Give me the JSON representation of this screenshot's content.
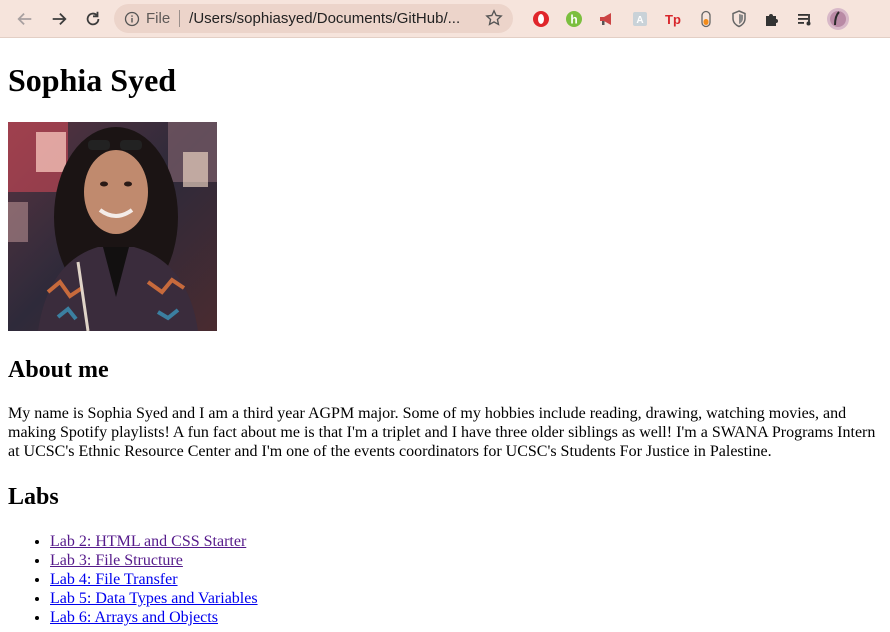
{
  "browser": {
    "scheme": "File",
    "url": "/Users/sophiasyed/Documents/GitHub/...",
    "extensions": [
      "opera-red-icon",
      "honey-h-icon",
      "megaphone-icon",
      "grammar-icon",
      "tp-icon",
      "capsule-icon",
      "shield-icon",
      "puzzle-icon",
      "playlist-icon",
      "profile-avatar"
    ],
    "colors": {
      "toolbar": "#f6e4dc",
      "omnibox": "#ecd4ca"
    }
  },
  "page": {
    "title": "Sophia Syed",
    "about_heading": "About me",
    "about_text": "My name is Sophia Syed and I am a third year AGPM major. Some of my hobbies include reading, drawing, watching movies, and making Spotify playlists! A fun fact about me is that I'm a triplet and I have three older siblings as well! I'm a SWANA Programs Intern at UCSC's Ethnic Resource Center and I'm one of the events coordinators for UCSC's Students For Justice in Palestine.",
    "labs_heading": "Labs",
    "labs": [
      {
        "label": "Lab 2: HTML and CSS Starter",
        "visited": true
      },
      {
        "label": "Lab 3: File Structure",
        "visited": true
      },
      {
        "label": "Lab 4: File Transfer",
        "visited": false
      },
      {
        "label": "Lab 5: Data Types and Variables",
        "visited": false
      },
      {
        "label": "Lab 6: Arrays and Objects",
        "visited": false
      }
    ]
  }
}
